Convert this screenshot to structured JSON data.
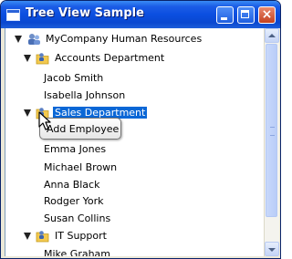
{
  "window": {
    "title": "Tree View Sample",
    "buttons": {
      "minimize": "minimize-icon",
      "maximize": "maximize-icon",
      "close": "close-icon",
      "close_glyph": "×"
    }
  },
  "tree": {
    "root": {
      "label": "MyCompany Human Resources",
      "icon": "people-icon"
    },
    "departments": [
      {
        "label": "Accounts Department",
        "icon": "folder-people-icon",
        "expanded": true,
        "employees": [
          "Jacob Smith",
          "Isabella Johnson"
        ]
      },
      {
        "label": "Sales Department",
        "icon": "folder-people-icon",
        "expanded": true,
        "selected": true,
        "employees": [
          "Emma Jones",
          "Michael Brown",
          "Anna Black",
          "Rodger York",
          "Susan Collins"
        ]
      },
      {
        "label": "IT Support",
        "icon": "folder-people-icon",
        "expanded": true,
        "employees": [
          "Mike Graham"
        ]
      }
    ]
  },
  "tooltip": {
    "label": "Add Employee"
  },
  "colors": {
    "selection": "#0a67d6",
    "titlebar": "#0b4ee0"
  }
}
